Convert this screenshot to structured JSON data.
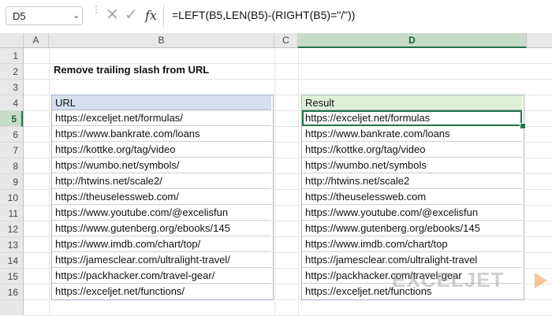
{
  "formula_bar": {
    "name_box": "D5",
    "cancel_icon": "×-icon",
    "enter_icon": "check-icon",
    "fx_label": "fx",
    "formula": "=LEFT(B5,LEN(B5)-(RIGHT(B5)=\"/\"))"
  },
  "columns": [
    "A",
    "B",
    "C",
    "D"
  ],
  "rows": [
    "1",
    "2",
    "3",
    "4",
    "5",
    "6",
    "7",
    "8",
    "9",
    "10",
    "11",
    "12",
    "13",
    "14",
    "15",
    "16"
  ],
  "active_cell": "D5",
  "title": "Remove trailing slash from URL",
  "url_table": {
    "header": "URL",
    "values": [
      "https://exceljet.net/formulas/",
      "https://www.bankrate.com/loans",
      "https://kottke.org/tag/video",
      "https://wumbo.net/symbols/",
      "http://htwins.net/scale2/",
      "https://theuselessweb.com/",
      "https://www.youtube.com/@excelisfun",
      "https://www.gutenberg.org/ebooks/145",
      "https://www.imdb.com/chart/top/",
      "https://jamesclear.com/ultralight-travel/",
      "https://packhacker.com/travel-gear/",
      "https://exceljet.net/functions/"
    ]
  },
  "result_table": {
    "header": "Result",
    "values": [
      "https://exceljet.net/formulas",
      "https://www.bankrate.com/loans",
      "https://kottke.org/tag/video",
      "https://wumbo.net/symbols",
      "http://htwins.net/scale2",
      "https://theuselessweb.com",
      "https://www.youtube.com/@excelisfun",
      "https://www.gutenberg.org/ebooks/145",
      "https://www.imdb.com/chart/top",
      "https://jamesclear.com/ultralight-travel",
      "https://packhacker.com/travel-gear",
      "https://exceljet.net/functions"
    ]
  },
  "watermark": "EXCELJET",
  "colors": {
    "accent": "#217346",
    "url_header_fill": "#d6dff0",
    "result_header_fill": "#dff0d8"
  }
}
